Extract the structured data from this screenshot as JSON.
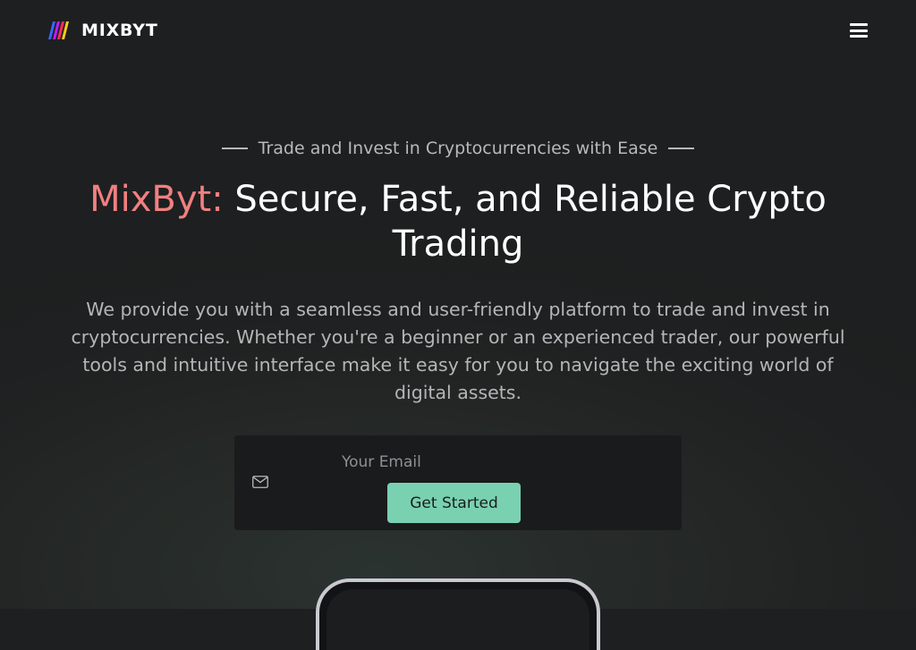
{
  "header": {
    "brand": "MIXBYT",
    "logo_icon": "mixbyt-logo-icon",
    "menu_icon": "hamburger-menu-icon"
  },
  "hero": {
    "kicker": "Trade and Invest in Cryptocurrencies with Ease",
    "headline_brand": "MixByt:",
    "headline_rest": " Secure, Fast, and Reliable Crypto Trading",
    "description": "We provide you with a seamless and user-friendly platform to trade and invest in cryptocurrencies. Whether you're a beginner or an experienced trader, our powerful tools and intuitive interface make it easy for you to navigate the exciting world of digital assets."
  },
  "signup": {
    "email_placeholder": "Your Email",
    "email_value": "",
    "mail_icon": "envelope-icon",
    "button_label": "Get Started"
  },
  "colors": {
    "accent": "#79d1b1",
    "brand_highlight": "#f08080",
    "background": "#1e1f20"
  }
}
